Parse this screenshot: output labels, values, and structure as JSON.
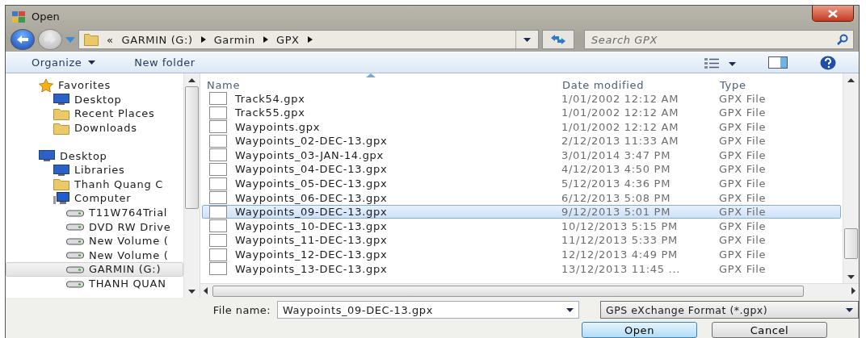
{
  "window": {
    "title": "Open"
  },
  "address": {
    "crumbs": [
      "«",
      "GARMIN (G:)",
      "Garmin",
      "GPX"
    ]
  },
  "search": {
    "placeholder": "Search GPX"
  },
  "toolbar": {
    "organize": "Organize",
    "new_folder": "New folder"
  },
  "sidebar": {
    "items": [
      {
        "label": "Favorites",
        "selected": false,
        "children": [
          {
            "label": "Desktop",
            "selected": false
          },
          {
            "label": "Recent Places",
            "selected": false
          },
          {
            "label": "Downloads",
            "selected": false
          }
        ]
      },
      {
        "label": "Desktop",
        "selected": false,
        "children": [
          {
            "label": "Libraries",
            "selected": false
          },
          {
            "label": "Thanh Quang C",
            "selected": false
          },
          {
            "label": "Computer",
            "selected": false,
            "children": [
              {
                "label": "T11W764Trial",
                "selected": false
              },
              {
                "label": "DVD RW Drive",
                "selected": false
              },
              {
                "label": "New Volume (",
                "selected": false
              },
              {
                "label": "New Volume (",
                "selected": false
              },
              {
                "label": "GARMIN (G:)",
                "selected": true
              },
              {
                "label": "THANH QUAN",
                "selected": false
              }
            ]
          }
        ]
      }
    ]
  },
  "table": {
    "columns": [
      "Name",
      "Date modified",
      "Type"
    ],
    "rows": [
      {
        "name": "Track54.gpx",
        "date": "1/01/2002 12:12 AM",
        "type": "GPX File",
        "selected": false
      },
      {
        "name": "Track55.gpx",
        "date": "1/01/2002 12:12 AM",
        "type": "GPX File",
        "selected": false
      },
      {
        "name": "Waypoints.gpx",
        "date": "1/01/2002 12:12 AM",
        "type": "GPX File",
        "selected": false
      },
      {
        "name": "Waypoints_02-DEC-13.gpx",
        "date": "2/12/2013 11:33 AM",
        "type": "GPX File",
        "selected": false
      },
      {
        "name": "Waypoints_03-JAN-14.gpx",
        "date": "3/01/2014 3:47 PM",
        "type": "GPX File",
        "selected": false
      },
      {
        "name": "Waypoints_04-DEC-13.gpx",
        "date": "4/12/2013 4:50 PM",
        "type": "GPX File",
        "selected": false
      },
      {
        "name": "Waypoints_05-DEC-13.gpx",
        "date": "5/12/2013 4:36 PM",
        "type": "GPX File",
        "selected": false
      },
      {
        "name": "Waypoints_06-DEC-13.gpx",
        "date": "6/12/2013 5:08 PM",
        "type": "GPX File",
        "selected": false
      },
      {
        "name": "Waypoints_09-DEC-13.gpx",
        "date": "9/12/2013 5:01 PM",
        "type": "GPX File",
        "selected": true
      },
      {
        "name": "Waypoints_10-DEC-13.gpx",
        "date": "10/12/2013 5:15 PM",
        "type": "GPX File",
        "selected": false
      },
      {
        "name": "Waypoints_11-DEC-13.gpx",
        "date": "11/12/2013 5:33 PM",
        "type": "GPX File",
        "selected": false
      },
      {
        "name": "Waypoints_12-DEC-13.gpx",
        "date": "12/12/2013 4:49 PM",
        "type": "GPX File",
        "selected": false
      },
      {
        "name": "Waypoints_13-DEC-13.gpx",
        "date": "13/12/2013 11:45 ...",
        "type": "GPX File",
        "selected": false
      }
    ]
  },
  "footer": {
    "file_name_label": "File name:",
    "file_name": "Waypoints_09-DEC-13.gpx",
    "filter": "GPS eXchange Format (*.gpx)",
    "open": "Open",
    "cancel": "Cancel"
  }
}
